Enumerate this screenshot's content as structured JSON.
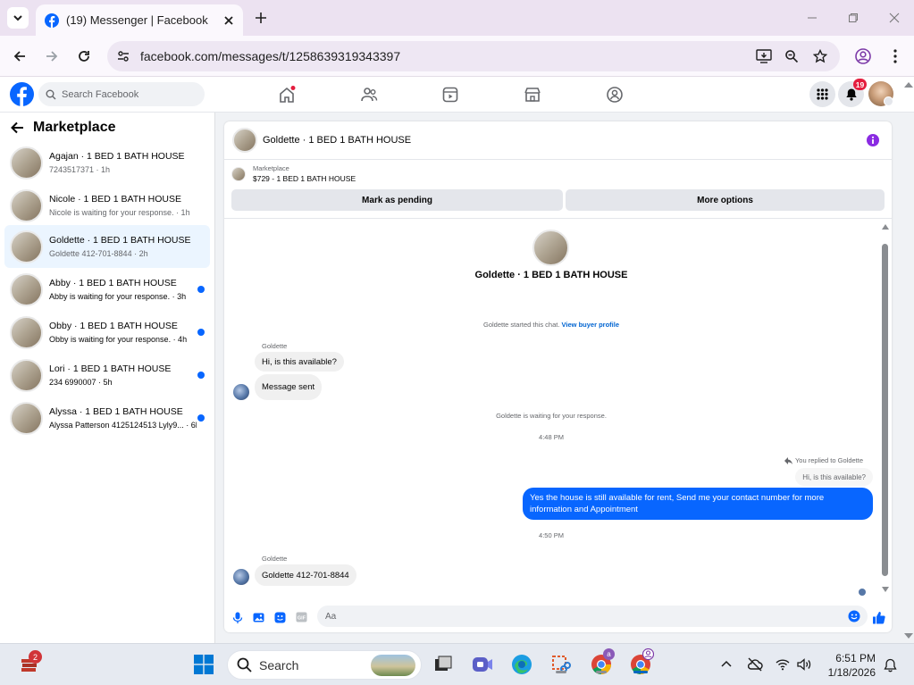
{
  "browser": {
    "tab_title": "(19) Messenger | Facebook",
    "url": "facebook.com/messages/t/1258639319343397"
  },
  "fbnav": {
    "search_placeholder": "Search Facebook",
    "notification_count": "19"
  },
  "sidebar": {
    "title": "Marketplace",
    "conversations": [
      {
        "name": "Agajan · 1 BED 1 BATH HOUSE",
        "snippet": "7243517371 · 1h",
        "unread": false,
        "active": false
      },
      {
        "name": "Nicole · 1 BED 1 BATH HOUSE",
        "snippet": "Nicole is waiting for your response. · 1h",
        "unread": false,
        "active": false
      },
      {
        "name": "Goldette · 1 BED 1 BATH HOUSE",
        "snippet": "Goldette 412-701-8844 · 2h",
        "unread": false,
        "active": true
      },
      {
        "name": "Abby · 1 BED 1 BATH HOUSE",
        "snippet": "Abby is waiting for your response. · 3h",
        "unread": true,
        "active": false
      },
      {
        "name": "Obby · 1 BED 1 BATH HOUSE",
        "snippet": "Obby is waiting for your response. · 4h",
        "unread": true,
        "active": false
      },
      {
        "name": "Lori · 1 BED 1 BATH HOUSE",
        "snippet": "234 6990007 · 5h",
        "unread": true,
        "active": false
      },
      {
        "name": "Alyssa · 1 BED 1 BATH HOUSE",
        "snippet": "Alyssa Patterson 4125124513 Lyly9... · 6h",
        "unread": true,
        "active": false
      }
    ]
  },
  "chat": {
    "title": "Goldette · 1 BED 1 BATH HOUSE",
    "marketplace_label": "Marketplace",
    "listing": "$729 - 1 BED 1 BATH HOUSE",
    "mark_pending": "Mark as pending",
    "more_options": "More options",
    "profile_title": "Goldette · 1 BED 1 BATH HOUSE",
    "started": "Goldette started this chat.",
    "view_buyer": "View buyer profile",
    "sender_1": "Goldette",
    "msg_1": "Hi, is this available?",
    "msg_2": "Message sent",
    "waiting": "Goldette is waiting for your response.",
    "time_1": "4:48 PM",
    "replied_to": "You replied to Goldette",
    "quoted": "Hi, is this available?",
    "my_reply": "Yes the house is still available for rent, Send me your contact number for more information and Appointment",
    "time_2": "4:50 PM",
    "sender_2": "Goldette",
    "msg_3": "Goldette 412-701-8844",
    "composer_placeholder": "Aa"
  },
  "taskbar": {
    "search_label": "Search",
    "time": "6:51 PM",
    "date": "1/18/2026",
    "app_badge": "2",
    "chrome_badge": "a"
  },
  "colors": {
    "accent": "#0866ff",
    "notification": "#e41e3f",
    "info_icon": "#8a2be2"
  }
}
